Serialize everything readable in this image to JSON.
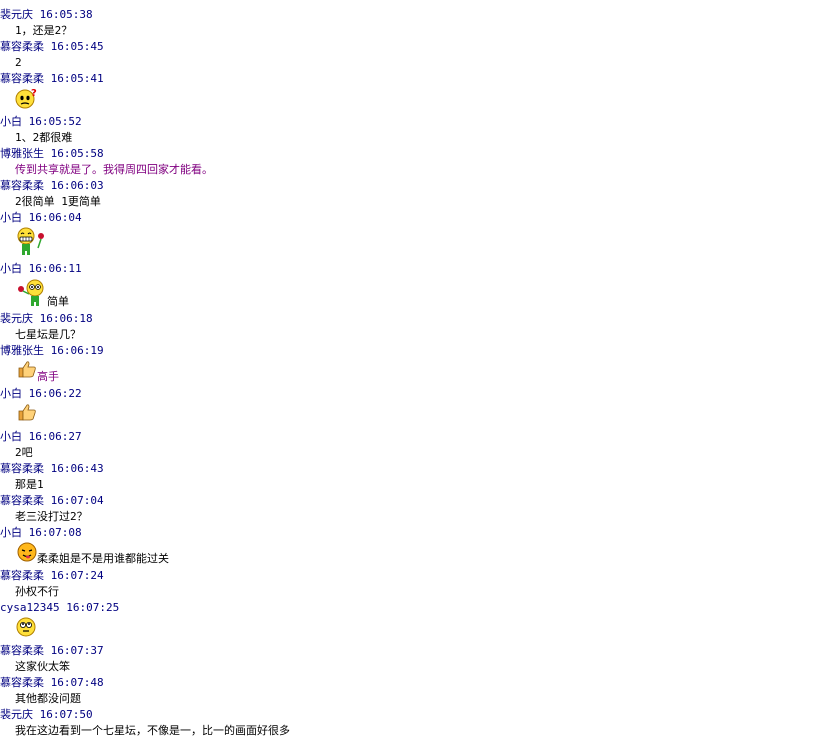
{
  "chat": {
    "m01": {
      "sender": "裴元庆",
      "time": "16:05:38",
      "text": "1，还是2？"
    },
    "m02": {
      "sender": "慕容柔柔",
      "time": "16:05:45",
      "text": "2"
    },
    "m03": {
      "sender": "慕容柔柔",
      "time": "16:05:41",
      "emoticon": "confused-question-icon"
    },
    "m04": {
      "sender": "小白",
      "time": "16:05:52",
      "text": "1、2都很难"
    },
    "m05": {
      "sender": "博雅张生",
      "time": "16:05:58",
      "text": "传到共享就是了。我得周四回家才能看。",
      "color": "#800080"
    },
    "m06": {
      "sender": "慕容柔柔",
      "time": "16:06:03",
      "text": "2很简单 1更简单"
    },
    "m07": {
      "sender": "小白",
      "time": "16:06:04",
      "emoticon": "grinning-flower-icon"
    },
    "m08": {
      "sender": "小白",
      "time": "16:06:11",
      "emoticon": "rose-giving-icon",
      "text": "简单"
    },
    "m09": {
      "sender": "裴元庆",
      "time": "16:06:18",
      "text": "七星坛是几？"
    },
    "m10": {
      "sender": "博雅张生",
      "time": "16:06:19",
      "emoticon": "thumbs-up-icon",
      "text": "高手",
      "color": "#800080"
    },
    "m11": {
      "sender": "小白",
      "time": "16:06:22",
      "emoticon": "thumbs-up-icon"
    },
    "m12": {
      "sender": "小白",
      "time": "16:06:27",
      "text": "2吧"
    },
    "m13": {
      "sender": "慕容柔柔",
      "time": "16:06:43",
      "text": "那是1"
    },
    "m14": {
      "sender": "慕容柔柔",
      "time": "16:07:04",
      "text": "老三没打过2？"
    },
    "m15": {
      "sender": "小白",
      "time": "16:07:08",
      "emoticon": "wink-tongue-icon",
      "text": "柔柔姐是不是用谁都能过关"
    },
    "m16": {
      "sender": "慕容柔柔",
      "time": "16:07:24",
      "text": "孙权不行"
    },
    "m17": {
      "sender": "cysa12345",
      "time": "16:07:25",
      "emoticon": "rolling-eyes-icon"
    },
    "m18": {
      "sender": "慕容柔柔",
      "time": "16:07:37",
      "text": "这家伙太笨"
    },
    "m19": {
      "sender": "慕容柔柔",
      "time": "16:07:48",
      "text": "其他都没问题"
    },
    "m20": {
      "sender": "裴元庆",
      "time": "16:07:50",
      "text": "我在这边看到一个七星坛，不像是一，比一的画面好很多"
    }
  },
  "colors": {
    "header": "#000080",
    "message": "#000000",
    "purple": "#800080",
    "background": "#ffffff"
  }
}
